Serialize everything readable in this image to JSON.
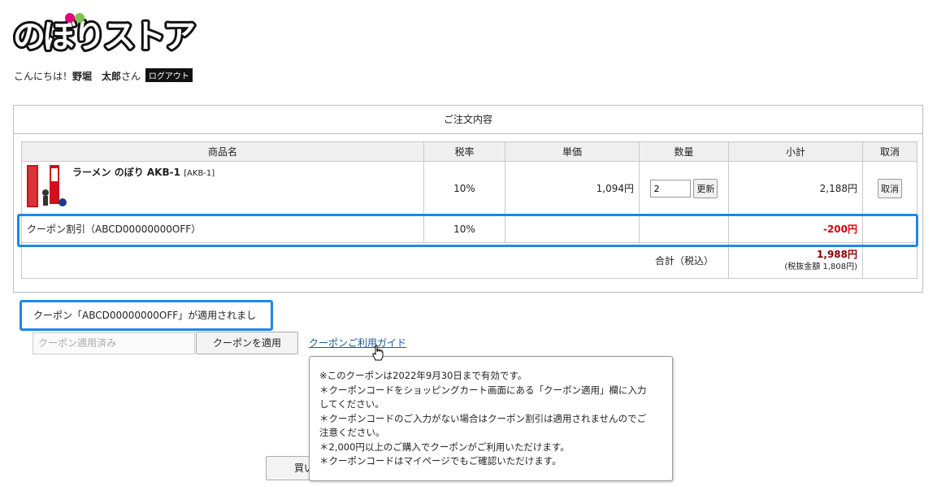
{
  "logo": {
    "text": "のぼりストア",
    "accent_color": "#e2007a",
    "dot_colors": [
      "#e2007a",
      "#7cc34d"
    ]
  },
  "greeting": {
    "prefix": "こんにちは！",
    "name": "野堀　太郎",
    "suffix": "さん",
    "logout_label": "ログアウト"
  },
  "order": {
    "title": "ご注文内容",
    "headers": [
      "商品名",
      "税率",
      "単価",
      "数量",
      "小計",
      "取消"
    ],
    "item": {
      "image_text": "ラーメン",
      "name": "ラーメン のぼり AKB-1",
      "code": "[AKB-1]",
      "tax_rate": "10%",
      "unit_price": "1,094円",
      "quantity": "2",
      "update_label": "更新",
      "subtotal": "2,188円",
      "cancel_label": "取消"
    },
    "coupon_row": {
      "label": "クーポン割引（ABCD00000000OFF）",
      "tax_rate": "10%",
      "amount": "-200円"
    },
    "total": {
      "label": "合計（税込）",
      "amount": "1,988円",
      "tax_excluded": "(税抜金額 1,808円)"
    }
  },
  "coupon": {
    "applied_message": "クーポン「ABCD00000000OFF」が適用されました。",
    "input_placeholder": "クーポン適用済み",
    "apply_label": "クーポンを適用",
    "guide_label": "クーポンご利用ガイド"
  },
  "tooltip": {
    "lines": [
      "※このクーポンは2022年9月30日まで有効です。",
      "＊クーポンコードをショッピングカート画面にある「クーポン適用」欄に入力",
      "してください。",
      "＊クーポンコードのご入力がない場合はクーポン割引は適用されませんのでご",
      "注意ください。",
      "＊2,000円以上のご購入でクーポンがご利用いただけます。",
      "＊クーポンコードはマイページでもご確認いただけます。"
    ]
  },
  "buy_button": {
    "label": "買い"
  },
  "colors": {
    "highlight": "#1e88e5",
    "discount": "#d8000c",
    "total": "#8a0000",
    "link": "#1a5a9a"
  }
}
